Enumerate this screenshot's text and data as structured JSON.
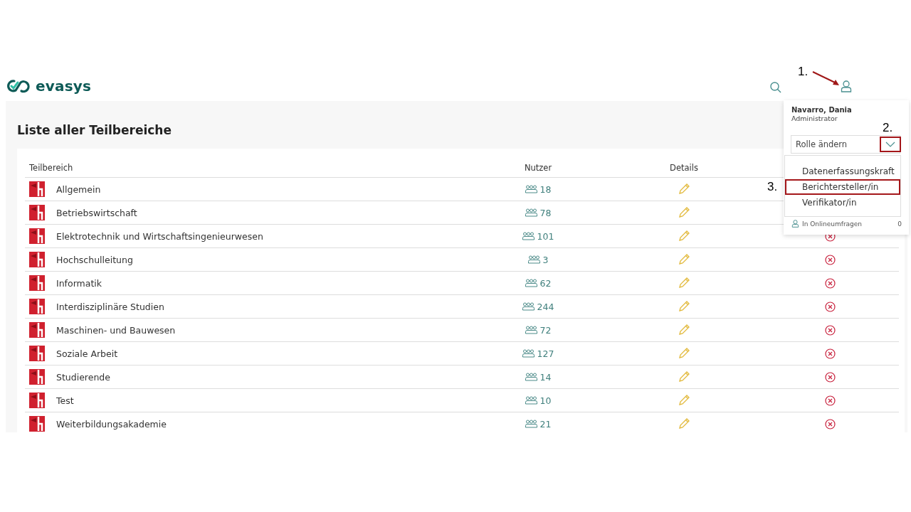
{
  "brand": {
    "name": "evasys"
  },
  "page": {
    "title": "Liste aller Teilbereiche"
  },
  "table": {
    "columns": [
      "Teilbereich",
      "Nutzer",
      "Details"
    ],
    "rows": [
      {
        "name": "Allgemein",
        "users": "18"
      },
      {
        "name": "Betriebswirtschaft",
        "users": "78"
      },
      {
        "name": "Elektrotechnik und Wirtschaftsingenieurwesen",
        "users": "101"
      },
      {
        "name": "Hochschulleitung",
        "users": "3"
      },
      {
        "name": "Informatik",
        "users": "62"
      },
      {
        "name": "Interdisziplinäre Studien",
        "users": "244"
      },
      {
        "name": "Maschinen- und Bauwesen",
        "users": "72"
      },
      {
        "name": "Soziale Arbeit",
        "users": "127"
      },
      {
        "name": "Studierende",
        "users": "14"
      },
      {
        "name": "Test",
        "users": "10"
      },
      {
        "name": "Weiterbildungsakademie",
        "users": "21"
      }
    ]
  },
  "user_menu": {
    "name": "Navarro, Dania",
    "role": "Administrator",
    "role_select": {
      "placeholder": "Rolle ändern",
      "marked": true
    },
    "role_options": [
      {
        "label": "Datenerfassungskraft",
        "marked": false
      },
      {
        "label": "Berichtersteller/in",
        "marked": true
      },
      {
        "label": "Verifikator/in",
        "marked": false
      }
    ],
    "partial_row": {
      "label": "In Onlineumfragen",
      "value": "0"
    }
  },
  "annotations": [
    "1.",
    "2.",
    "3."
  ]
}
